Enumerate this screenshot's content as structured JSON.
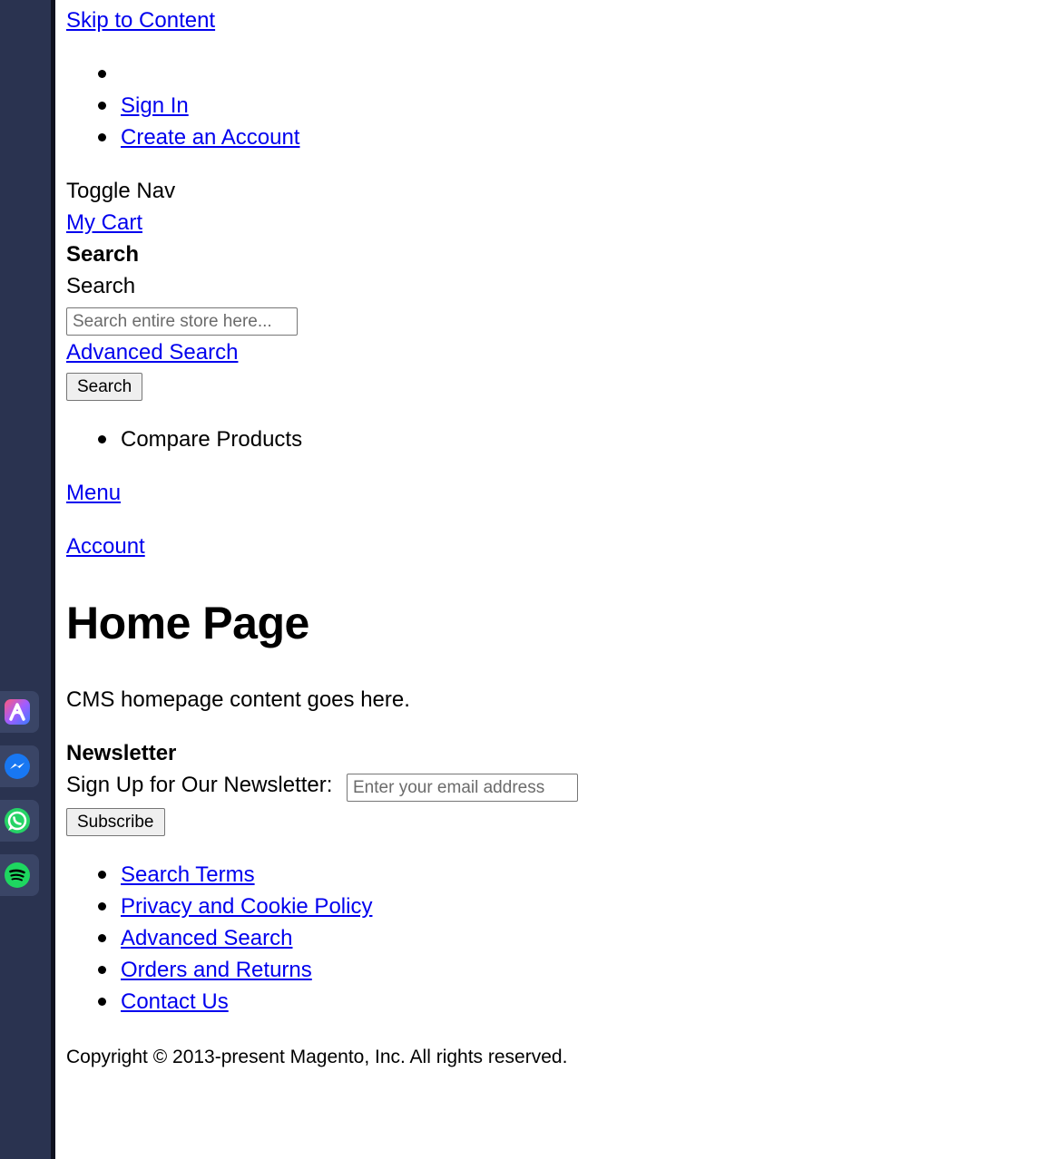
{
  "dock": {
    "apps": [
      {
        "name": "arc-app-icon"
      },
      {
        "name": "messenger-icon"
      },
      {
        "name": "whatsapp-icon"
      },
      {
        "name": "spotify-icon"
      }
    ]
  },
  "header": {
    "skip_link": "Skip to Content",
    "account_links": [
      "",
      "Sign In",
      "Create an Account"
    ],
    "toggle_nav": "Toggle Nav",
    "cart_link": "My Cart",
    "search_heading": "Search",
    "search_label": "Search",
    "search_placeholder": "Search entire store here...",
    "advanced_search": "Advanced Search",
    "search_button": "Search",
    "compare_items": [
      "Compare Products"
    ],
    "menu_link": "Menu",
    "account_link": "Account"
  },
  "main": {
    "title": "Home Page",
    "content": "CMS homepage content goes here."
  },
  "newsletter": {
    "heading": "Newsletter",
    "label": "Sign Up for Our Newsletter:",
    "placeholder": "Enter your email address",
    "button": "Subscribe"
  },
  "footer": {
    "links": [
      "Search Terms",
      "Privacy and Cookie Policy",
      "Advanced Search",
      "Orders and Returns",
      "Contact Us"
    ],
    "copyright": "Copyright © 2013-present Magento, Inc. All rights reserved."
  },
  "colors": {
    "link": "#0000ee",
    "dock_background": "#2a3350"
  }
}
